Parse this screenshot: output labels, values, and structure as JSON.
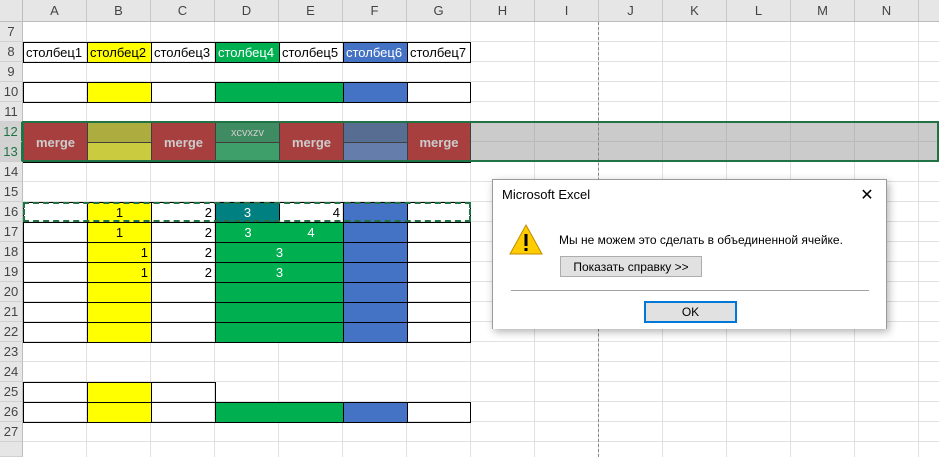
{
  "columns": [
    "A",
    "B",
    "C",
    "D",
    "E",
    "F",
    "G",
    "H",
    "I",
    "J",
    "K",
    "L",
    "M",
    "N"
  ],
  "rows": [
    "7",
    "8",
    "9",
    "10",
    "11",
    "12",
    "13",
    "14",
    "15",
    "16",
    "17",
    "18",
    "19",
    "20",
    "21",
    "22",
    "23",
    "24",
    "25",
    "26",
    "27"
  ],
  "colors": {
    "yellow": "#ffff00",
    "green": "#00b050",
    "blue": "#4472c4",
    "red": "#c00000",
    "teal": "#008080",
    "olive": "#c9c900",
    "dark_green": "#008c40",
    "dark_blue": "#2f5597"
  },
  "cells": {
    "A8": "столбец1",
    "B8": "столбец2",
    "C8": "столбец3",
    "D8": "столбец4",
    "E8": "столбец5",
    "F8": "столбец6",
    "G8": "столбец7",
    "A12": "merge",
    "C12": "merge",
    "D12": "xcvxzv",
    "E12": "merge",
    "G12": "merge",
    "B16": "1",
    "C16": "2",
    "D16": "3",
    "E16": "4",
    "B17": "1",
    "C17": "2",
    "D17": "3",
    "E17": "4",
    "B18": "1",
    "C18": "2",
    "D18": "3",
    "B19": "1",
    "C19": "2",
    "D19": "3"
  },
  "dialog": {
    "title": "Microsoft Excel",
    "close": "✕",
    "message": "Мы не можем это сделать в объединенной ячейке.",
    "help_button": "Показать справку >>",
    "ok_button": "OK",
    "icon": "warning-icon"
  }
}
